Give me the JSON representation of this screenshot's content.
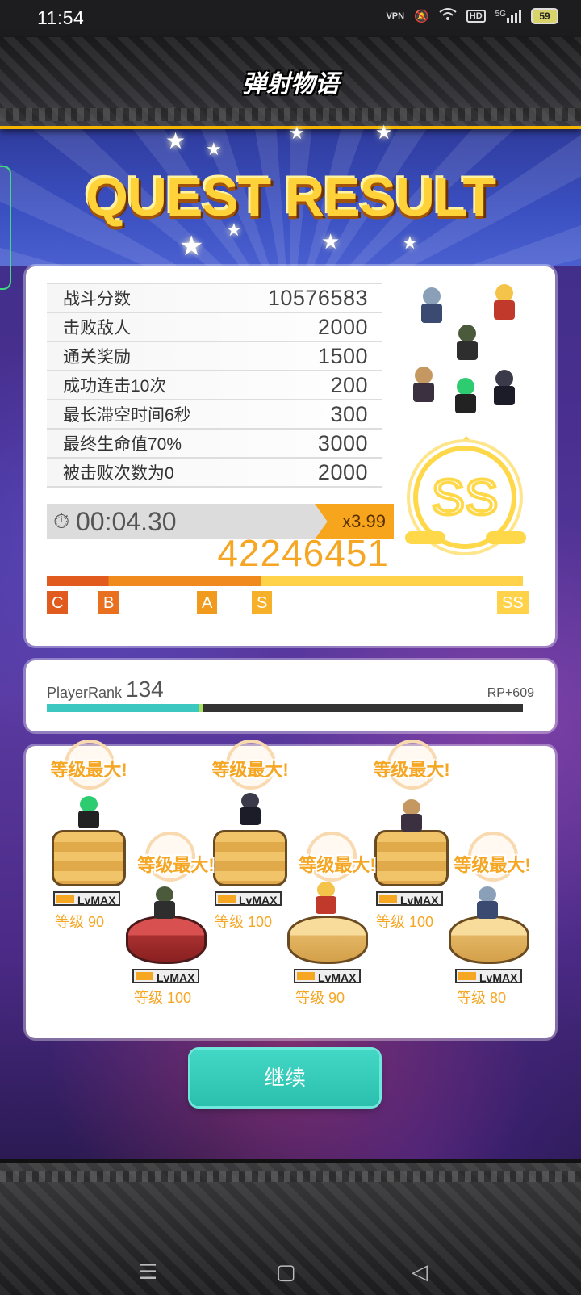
{
  "status_bar": {
    "time": "11:54",
    "icons": [
      "vpn-icon",
      "mute-bell-icon",
      "wifi-icon",
      "hd-icon",
      "5g-signal-icon",
      "battery-icon"
    ],
    "vpn_label": "VPN",
    "hd_label": "HD",
    "network_label": "5G",
    "battery_level": "59"
  },
  "header": {
    "logo_text": "弹射物语",
    "title": "QUEST RESULT"
  },
  "score": {
    "rows": [
      {
        "label": "战斗分数",
        "value": "10576583"
      },
      {
        "label": "击败敌人",
        "value": "2000"
      },
      {
        "label": "通关奖励",
        "value": "1500"
      },
      {
        "label": "成功连击10次",
        "value": "200"
      },
      {
        "label": "最长滞空时间6秒",
        "value": "300"
      },
      {
        "label": "最终生命值70%",
        "value": "3000"
      },
      {
        "label": "被击败次数为0",
        "value": "2000"
      }
    ],
    "timer": "00:04.30",
    "multiplier": "x3.99",
    "total": "42246451",
    "rank": "SS",
    "rank_scale": [
      "C",
      "B",
      "A",
      "S",
      "SS"
    ]
  },
  "player_rank": {
    "label": "PlayerRank",
    "value": "134",
    "rp": "RP+609",
    "progress_fraction": 0.32
  },
  "party": {
    "units": [
      {
        "max_label": "等级最大!",
        "lv_tag": "LvMAX",
        "level_label": "等级 90"
      },
      {
        "max_label": "等级最大!",
        "lv_tag": "LvMAX",
        "level_label": "等级 100"
      },
      {
        "max_label": "等级最大!",
        "lv_tag": "LvMAX",
        "level_label": "等级 100"
      },
      {
        "max_label": "等级最大!",
        "lv_tag": "LvMAX",
        "level_label": "等级 90"
      },
      {
        "max_label": "等级最大!",
        "lv_tag": "LvMAX",
        "level_label": "等级 100"
      },
      {
        "max_label": "等级最大!",
        "lv_tag": "LvMAX",
        "level_label": "等级 80"
      }
    ]
  },
  "actions": {
    "continue_label": "继续"
  },
  "colors": {
    "accent_orange": "#f5a623",
    "gold": "#ffd23a",
    "teal_button": "#2bbfad",
    "rank_bar_fill": "#3cc8c0"
  }
}
